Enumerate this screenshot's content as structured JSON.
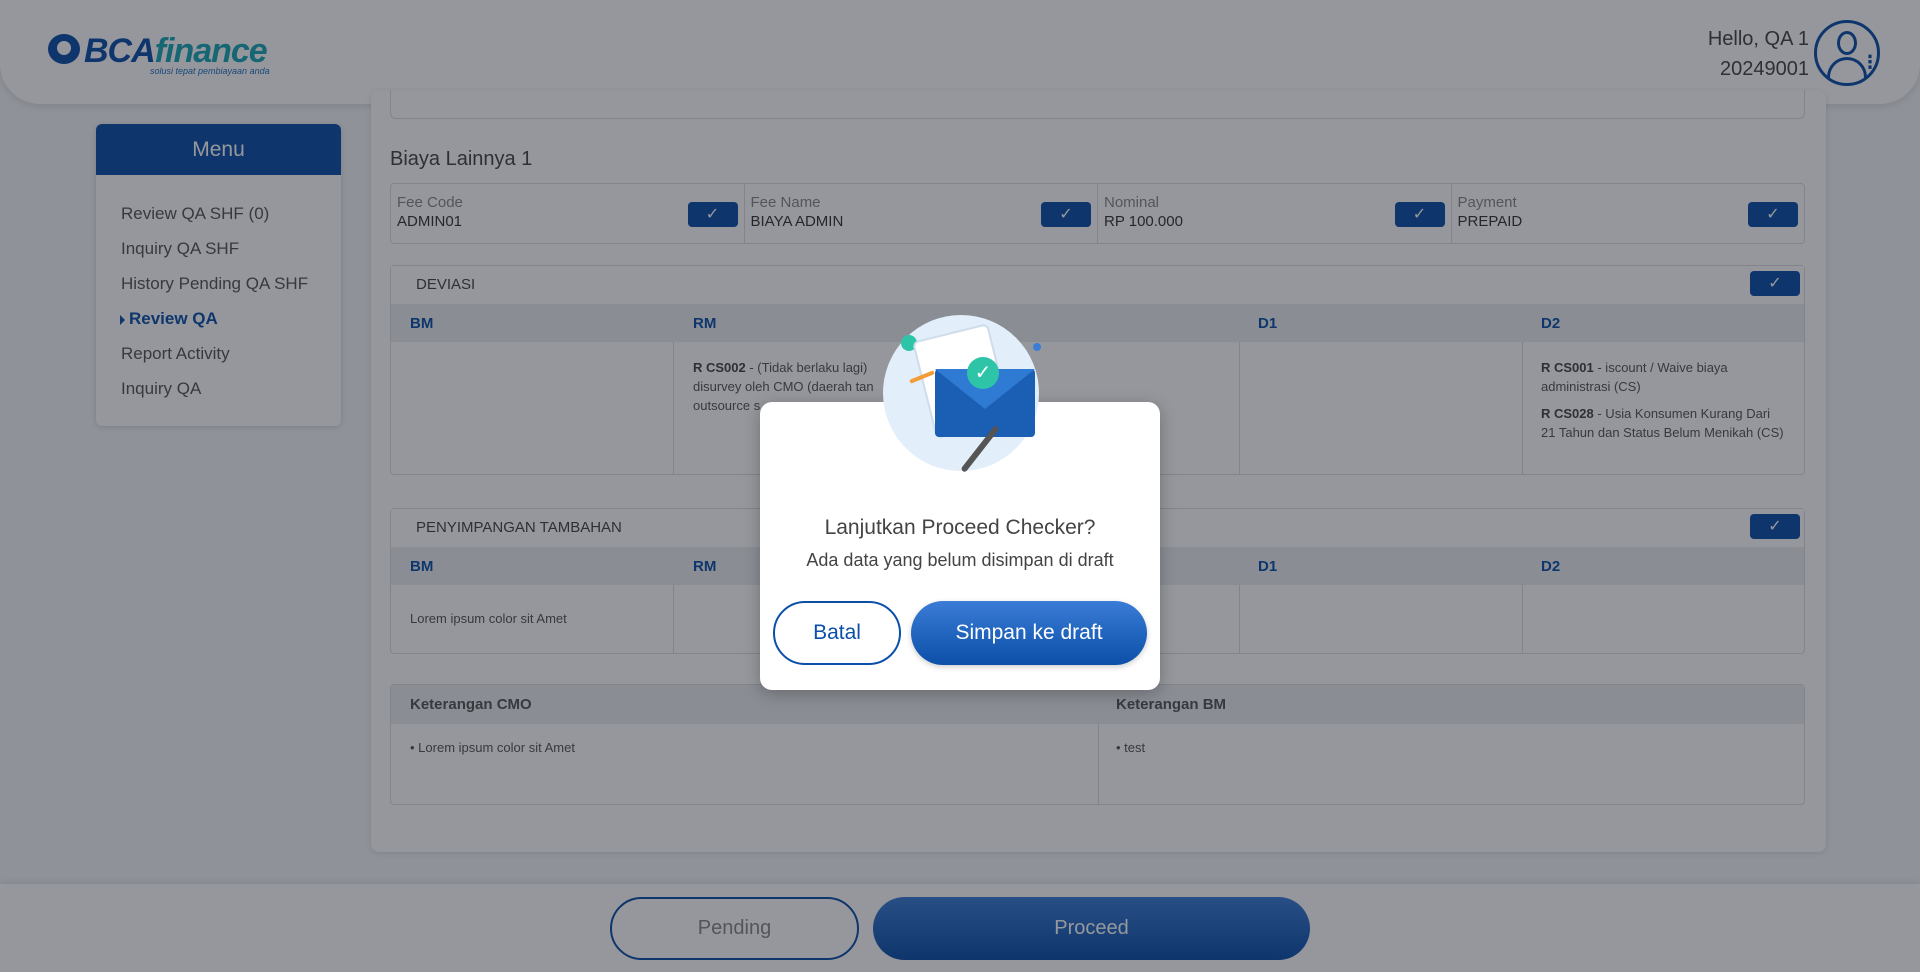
{
  "header": {
    "logo_brand": "BCA",
    "logo_suffix": "finance",
    "logo_tagline": "solusi tepat pembiayaan anda",
    "greeting": "Hello, QA 1",
    "user_id": "20249001"
  },
  "sidebar": {
    "title": "Menu",
    "items": [
      {
        "label": "Review QA SHF (0)",
        "active": false
      },
      {
        "label": "Inquiry QA SHF",
        "active": false
      },
      {
        "label": "History Pending QA SHF",
        "active": false
      },
      {
        "label": "Review QA",
        "active": true
      },
      {
        "label": "Report Activity",
        "active": false
      },
      {
        "label": "Inquiry QA",
        "active": false
      }
    ]
  },
  "main": {
    "section_title": "Biaya Lainnya 1",
    "fees": [
      {
        "label": "Fee Code",
        "value": "ADMIN01"
      },
      {
        "label": "Fee Name",
        "value": "BIAYA ADMIN"
      },
      {
        "label": "Nominal",
        "value": "RP 100.000"
      },
      {
        "label": "Payment",
        "value": "PREPAID"
      }
    ],
    "deviasi": {
      "title": "DEVIASI",
      "columns": [
        "BM",
        "RM",
        "D1",
        "D2"
      ],
      "rm_code": "R CS002",
      "rm_text_1": " - (Tidak berlaku lagi)",
      "rm_text_2": "disurvey oleh CMO (daerah tan",
      "rm_text_3": "outsource s",
      "d2_code_1": "R CS001",
      "d2_text_1a": " - iscount / Waive biaya",
      "d2_text_1b": "administrasi (CS)",
      "d2_code_2": "R CS028",
      "d2_text_2a": " - Usia Konsumen Kurang Dari",
      "d2_text_2b": "21 Tahun dan Status Belum Menikah (CS)"
    },
    "penyimpangan": {
      "title": "PENYIMPANGAN TAMBAHAN",
      "columns": [
        "BM",
        "RM",
        "D1",
        "D2"
      ],
      "bm_text": "Lorem ipsum color sit Amet"
    },
    "keterangan": {
      "cmo_label": "Keterangan CMO",
      "bm_label": "Keterangan BM",
      "cmo_value": "Lorem ipsum color sit Amet",
      "bm_value": "test"
    }
  },
  "footer": {
    "pending_label": "Pending",
    "proceed_label": "Proceed"
  },
  "modal": {
    "title": "Lanjutkan Proceed Checker?",
    "subtitle": "Ada data yang belum disimpan di draft",
    "cancel_label": "Batal",
    "confirm_label": "Simpan ke draft"
  },
  "colors": {
    "primary": "#0b4fa8",
    "accent_teal": "#2ec4a8",
    "overlay": "rgba(20,25,35,0.45)"
  },
  "icons": {
    "check": "✓",
    "menu_dots": "⋮"
  }
}
